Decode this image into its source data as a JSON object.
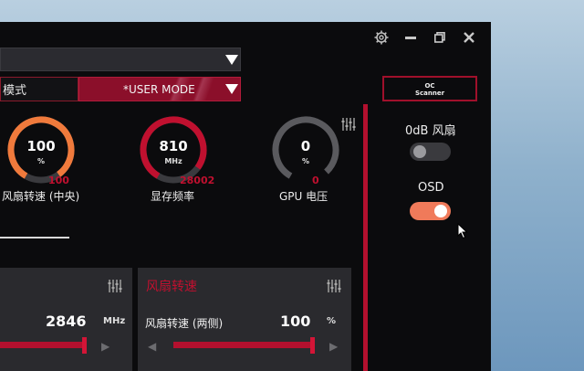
{
  "window": {
    "settings_icon": "gear-icon",
    "minimize_icon": "minimize-icon",
    "restore_icon": "restore-icon",
    "close_icon": "close-icon"
  },
  "profile": {
    "top_dropdown_value": "",
    "mode_left_label": "模式",
    "mode_right_label": "*USER MODE"
  },
  "gauges": [
    {
      "value": "100",
      "unit": "%",
      "sub": "100",
      "label": "风扇转速 (中央)",
      "color": "#f07a3c"
    },
    {
      "value": "810",
      "unit": "MHz",
      "sub": "28002",
      "label": "显存频率",
      "color": "#c0102f"
    },
    {
      "value": "0",
      "unit": "%",
      "sub": "0",
      "label": "GPU 电压",
      "color": "#5a5a5e"
    }
  ],
  "panel_left": {
    "value": "2846",
    "unit": "MHz",
    "slider_level": 0.95
  },
  "panel_fan": {
    "title": "风扇转速",
    "row_label": "风扇转速 (两侧)",
    "value": "100",
    "unit": "%",
    "slider_level": 1.0
  },
  "right_panel": {
    "oc_scanner_line1": "OC",
    "oc_scanner_line2": "Scanner",
    "zero_db_label": "0dB 风扇",
    "zero_db_on": false,
    "osd_label": "OSD",
    "osd_on": true
  },
  "colors": {
    "accent_red": "#c0102f",
    "toggle_on": "#f07a5a",
    "toggle_off": "#3a3a3e"
  }
}
